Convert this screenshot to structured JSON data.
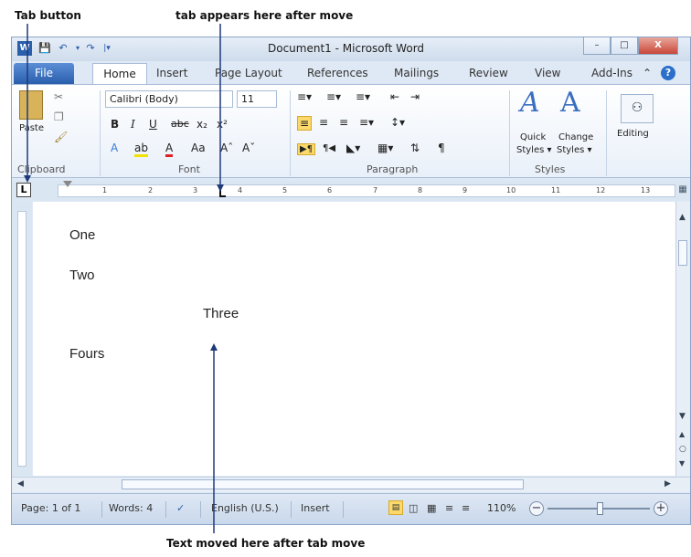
{
  "callouts": {
    "tab_button": "Tab button",
    "tab_appears": "tab appears here after move",
    "text_moved": "Text moved here after tab move"
  },
  "window": {
    "title": "Document1  -  Microsoft Word",
    "minimize": "–",
    "maximize": "□",
    "close": "X"
  },
  "quick_access": {
    "save_icon": "save-icon",
    "undo_icon": "undo-icon",
    "redo_icon": "redo-icon"
  },
  "tabs": [
    "File",
    "Home",
    "Insert",
    "Page Layout",
    "References",
    "Mailings",
    "Review",
    "View",
    "Add-Ins"
  ],
  "ribbon": {
    "clipboard": {
      "paste": "Paste",
      "label": "Clipboard"
    },
    "font": {
      "name": "Calibri (Body)",
      "size": "11",
      "label": "Font",
      "bold": "B",
      "italic": "I",
      "underline": "U",
      "grow": "Aˆ",
      "shrink": "Aˇ"
    },
    "paragraph": {
      "label": "Paragraph",
      "pilcrow": "¶"
    },
    "styles": {
      "quick": "Quick",
      "quick2": "Styles ▾",
      "change": "Change",
      "change2": "Styles ▾",
      "label": "Styles"
    },
    "editing": {
      "label": "Editing"
    }
  },
  "ruler": {
    "tab_selector": "L",
    "ticks": [
      "1",
      "2",
      "3",
      "4",
      "5",
      "6",
      "7",
      "8",
      "9",
      "10",
      "11",
      "12",
      "13"
    ]
  },
  "document": {
    "lines": [
      "One",
      "Two",
      "Three",
      "Fours"
    ]
  },
  "status": {
    "page": "Page: 1 of 1",
    "words": "Words: 4",
    "language": "English (U.S.)",
    "mode": "Insert",
    "zoom": "110%"
  },
  "colors": {
    "accent": "#2a5fad",
    "arrow": "#1f3a7a",
    "close": "#c8463a"
  }
}
